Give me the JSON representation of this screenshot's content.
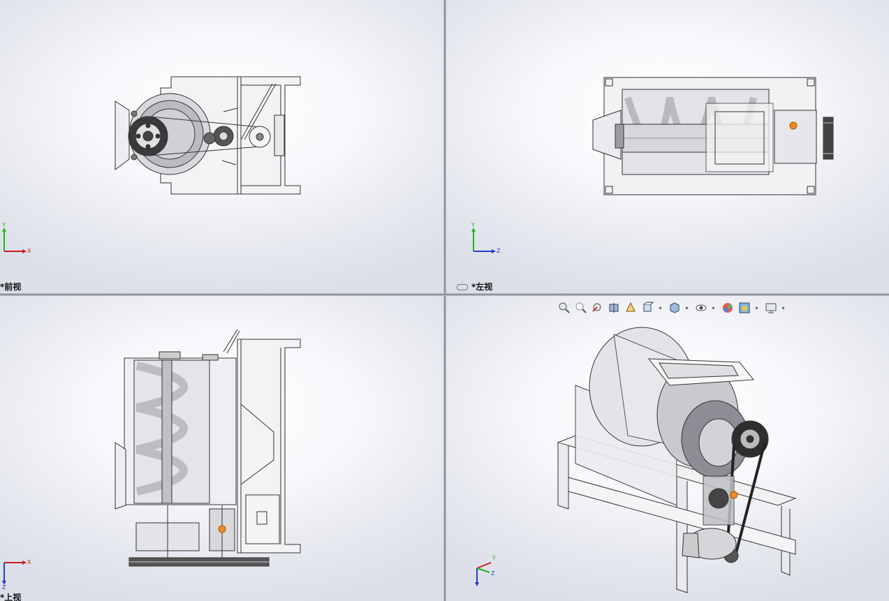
{
  "viewports": {
    "front": {
      "label": "*前视",
      "axes": {
        "up": "Y",
        "right": "X"
      }
    },
    "left": {
      "label": "*左视",
      "axes": {
        "up": "Y",
        "right": "Z"
      }
    },
    "top": {
      "label": "*上视",
      "axes": {
        "right": "X",
        "down": "Z"
      }
    },
    "iso": {
      "axes": {
        "up": "Y",
        "right": "X",
        "front": "Z"
      }
    }
  },
  "toolbar": {
    "items": [
      {
        "name": "zoom-to-fit-icon",
        "dropdown": false
      },
      {
        "name": "zoom-to-area-icon",
        "dropdown": false
      },
      {
        "name": "previous-view-icon",
        "dropdown": false
      },
      {
        "name": "section-view-icon",
        "dropdown": false
      },
      {
        "name": "dynamic-annotation-icon",
        "dropdown": false
      },
      {
        "name": "view-orientation-icon",
        "dropdown": true
      },
      {
        "name": "display-style-icon",
        "dropdown": true
      },
      {
        "name": "hide-show-items-icon",
        "dropdown": true
      },
      {
        "name": "edit-appearance-icon",
        "dropdown": false
      },
      {
        "name": "apply-scene-icon",
        "dropdown": true
      },
      {
        "name": "view-settings-icon",
        "dropdown": true
      }
    ]
  },
  "colors": {
    "axis_x": "#cc1e1e",
    "axis_y": "#22b222",
    "axis_z": "#1f3fbf",
    "highlight": "#f08a24"
  }
}
